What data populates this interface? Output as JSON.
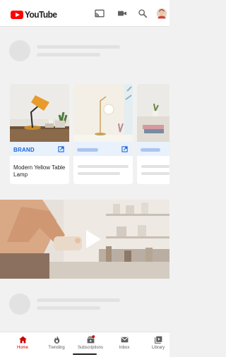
{
  "app": {
    "logo_text": "YouTube"
  },
  "header_icons": [
    "cast-icon",
    "camera-icon",
    "search-icon",
    "avatar"
  ],
  "cards": [
    {
      "brand": "BRAND",
      "title": "Modern Yellow Table Lamp"
    }
  ],
  "nav": {
    "items": [
      {
        "label": "Home",
        "icon": "home-icon",
        "active": true
      },
      {
        "label": "Trending",
        "icon": "flame-icon",
        "active": false
      },
      {
        "label": "Subscriptions",
        "icon": "subscriptions-icon",
        "active": false
      },
      {
        "label": "Inbox",
        "icon": "inbox-icon",
        "active": false
      },
      {
        "label": "Library",
        "icon": "library-icon",
        "active": false
      }
    ]
  },
  "colors": {
    "brand_red": "#ff0000",
    "accent_blue": "#1967d2",
    "active_red": "#cc0000"
  }
}
